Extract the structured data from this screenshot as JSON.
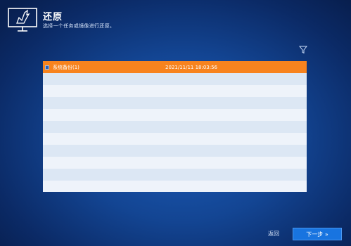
{
  "header": {
    "title": "还原",
    "subtitle": "选择一个任务或镜像进行还原。",
    "icon": "monitor-restore-icon"
  },
  "toolbar": {
    "filter_icon": "filter-icon"
  },
  "list": {
    "rows": [
      {
        "name": "系统备份(1)",
        "time": "2021/11/11 18:03:56",
        "selected": true
      }
    ],
    "empty_rows": 10
  },
  "footer": {
    "back_label": "返回",
    "next_label": "下一步 »"
  },
  "colors": {
    "selected": "#f7831e",
    "next_button": "#1874e0"
  }
}
